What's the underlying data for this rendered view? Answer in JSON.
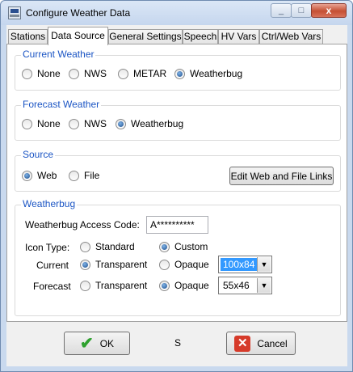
{
  "window": {
    "title": "Configure Weather Data",
    "close_glyph": "x",
    "minimize_glyph": "_",
    "maximize_glyph": "□",
    "icon": "weather-app-icon"
  },
  "tabs": [
    {
      "label": "Stations",
      "active": false
    },
    {
      "label": "Data Source",
      "active": true
    },
    {
      "label": "General Settings",
      "active": false
    },
    {
      "label": "Speech",
      "active": false
    },
    {
      "label": "HV Vars",
      "active": false
    },
    {
      "label": "Ctrl/Web Vars",
      "active": false
    }
  ],
  "current_weather": {
    "title": "Current Weather",
    "options": [
      "None",
      "NWS",
      "METAR",
      "Weatherbug"
    ],
    "selected": "Weatherbug"
  },
  "forecast_weather": {
    "title": "Forecast Weather",
    "options": [
      "None",
      "NWS",
      "Weatherbug"
    ],
    "selected": "Weatherbug"
  },
  "source": {
    "title": "Source",
    "options": [
      "Web",
      "File"
    ],
    "selected": "Web",
    "edit_links_label": "Edit Web and File Links"
  },
  "weatherbug": {
    "title": "Weatherbug",
    "access_code_label": "Weatherbug Access Code:",
    "access_code_value": "A**********",
    "icon_type_label": "Icon Type:",
    "icon_type_options": [
      "Standard",
      "Custom"
    ],
    "icon_type_selected": "Custom",
    "current_label": "Current",
    "current_options": [
      "Transparent",
      "Opaque"
    ],
    "current_selected": "Transparent",
    "current_size": "100x84",
    "forecast_label": "Forecast",
    "forecast_options": [
      "Transparent",
      "Opaque"
    ],
    "forecast_selected": "Opaque",
    "forecast_size": "55x46"
  },
  "footer": {
    "ok_label": "OK",
    "middle_text": "S",
    "cancel_label": "Cancel"
  },
  "colors": {
    "group_title": "#1b55c4",
    "ok_check": "#2ea12e",
    "cancel_x": "#d63a2a",
    "selection": "#3399ff"
  }
}
